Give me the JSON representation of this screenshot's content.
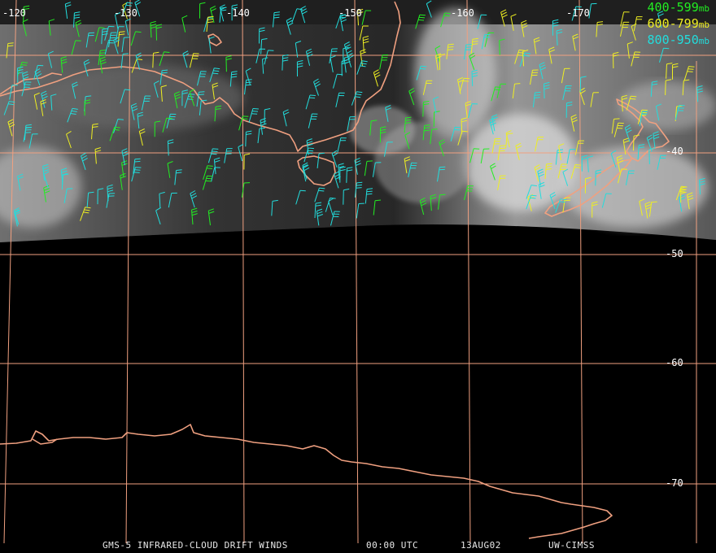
{
  "map": {
    "longitude_labels": [
      "-120",
      "-130",
      "-140",
      "-150",
      "-160",
      "-170"
    ],
    "latitude_labels": [
      "-40",
      "-50",
      "-60",
      "-70"
    ]
  },
  "legend": [
    {
      "range": "400-599",
      "unit": "mb",
      "color": "#22ee22"
    },
    {
      "range": "600-799",
      "unit": "mb",
      "color": "#eeee22"
    },
    {
      "range": "800-950",
      "unit": "mb",
      "color": "#22dddd"
    }
  ],
  "footer": {
    "product": "GMS-5 INFRARED-CLOUD DRIFT WINDS",
    "time": "00:00 UTC",
    "date": "13AUG02",
    "source": "UW-CIMSS"
  },
  "colors": {
    "grid": "#f0a080",
    "coastline": "#f0a080",
    "background": "#000000"
  }
}
